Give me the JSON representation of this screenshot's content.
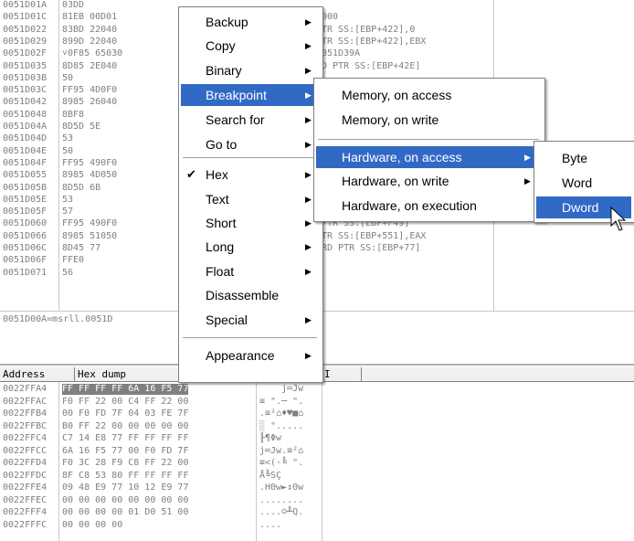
{
  "disasm": {
    "rows": [
      {
        "addr": "0051D01A",
        "hex": "03DD",
        "cmt": ""
      },
      {
        "addr": "0051D01C",
        "hex": "81EB 00D01",
        "cmt": "000"
      },
      {
        "addr": "0051D022",
        "hex": "83BD 22040",
        "cmt": "TR SS:[EBP+422],0"
      },
      {
        "addr": "0051D029",
        "hex": "899D 22040",
        "cmt": "TR SS:[EBP+422],EBX"
      },
      {
        "addr": "0051D02F",
        "hex": "˅0F85 65030",
        "cmt": "051D39A"
      },
      {
        "addr": "0051D035",
        "hex": "8D85 2E040",
        "cmt": "D PTR SS:[EBP+42E]"
      },
      {
        "addr": "0051D03B",
        "hex": "50",
        "cmt": ""
      },
      {
        "addr": "0051D03C",
        "hex": "FF95 4D0F0",
        "cmt": ""
      },
      {
        "addr": "0051D042",
        "hex": "8985 26040",
        "cmt": ""
      },
      {
        "addr": "0051D048",
        "hex": "8BF8",
        "cmt": ""
      },
      {
        "addr": "0051D04A",
        "hex": "8D5D 5E",
        "cmt": ""
      },
      {
        "addr": "0051D04D",
        "hex": "53",
        "cmt": ""
      },
      {
        "addr": "0051D04E",
        "hex": "50",
        "cmt": ""
      },
      {
        "addr": "0051D04F",
        "hex": "FF95 490F0",
        "cmt": ""
      },
      {
        "addr": "0051D055",
        "hex": "8985 4D050",
        "cmt": ""
      },
      {
        "addr": "0051D05B",
        "hex": "8D5D 6B",
        "cmt": ""
      },
      {
        "addr": "0051D05E",
        "hex": "53",
        "cmt": ""
      },
      {
        "addr": "0051D05F",
        "hex": "57",
        "cmt": ""
      },
      {
        "addr": "0051D060",
        "hex": "FF95 490F0",
        "cmt": "PTR SS:[EBP+F49]"
      },
      {
        "addr": "0051D066",
        "hex": "8985 51050",
        "cmt": "TR SS:[EBP+551],EAX"
      },
      {
        "addr": "0051D06C",
        "hex": "8D45 77",
        "cmt": "RD PTR SS:[EBP+77]"
      },
      {
        "addr": "0051D06F",
        "hex": "FFE0",
        "cmt": ""
      },
      {
        "addr": "0051D071",
        "hex": "56",
        "cmt": ""
      }
    ]
  },
  "info_line": "0051D00A=msrll.0051D",
  "dump": {
    "header": {
      "address": "Address",
      "hex": "Hex dump",
      "ascii": "I"
    },
    "rows": [
      {
        "addr": "0022FFA4",
        "hex": "FF FF FF FF 6A 16 F5 77",
        "ascii": "    j═Jw"
      },
      {
        "addr": "0022FFAC",
        "hex": "F0 FF 22 00 C4 FF 22 00",
        "ascii": "≡ \".─ \"."
      },
      {
        "addr": "0022FFB4",
        "hex": "00 F0 FD 7F 04 03 FE 7F",
        "ascii": ".≡²⌂♦♥■⌂"
      },
      {
        "addr": "0022FFBC",
        "hex": "B0 FF 22 00 00 00 00 00",
        "ascii": "░ \"....."
      },
      {
        "addr": "0022FFC4",
        "hex": "C7 14 E8 77 FF FF FF FF",
        "ascii": "╟¶Φw    "
      },
      {
        "addr": "0022FFCC",
        "hex": "6A 16 F5 77 00 F0 FD 7F",
        "ascii": "j═Jw.≡²⌂"
      },
      {
        "addr": "0022FFD4",
        "hex": "F0 3C 28 F9 C8 FF 22 00",
        "ascii": "≡<(·╚ \"."
      },
      {
        "addr": "0022FFDC",
        "hex": "8F C8 53 80 FF FF FF FF",
        "ascii": "Å╚SÇ    "
      },
      {
        "addr": "0022FFE4",
        "hex": "09 48 E9 77 10 12 E9 77",
        "ascii": ".HΘw►↕Θw"
      },
      {
        "addr": "0022FFEC",
        "hex": "00 00 00 00 00 00 00 00",
        "ascii": "........"
      },
      {
        "addr": "0022FFF4",
        "hex": "00 00 00 00 01 D0 51 00",
        "ascii": "....☺╨Q."
      },
      {
        "addr": "0022FFFC",
        "hex": "00 00 00 00",
        "ascii": "...."
      }
    ]
  },
  "context_menu": {
    "items": [
      {
        "label": "Backup",
        "submenu": true
      },
      {
        "label": "Copy",
        "submenu": true
      },
      {
        "label": "Binary",
        "submenu": true
      },
      {
        "label": "Breakpoint",
        "submenu": true,
        "selected": true
      },
      {
        "label": "Search for",
        "submenu": true
      },
      {
        "label": "Go to",
        "submenu": true
      },
      {
        "label": "Hex",
        "submenu": true,
        "checked": true
      },
      {
        "label": "Text",
        "submenu": true
      },
      {
        "label": "Short",
        "submenu": true
      },
      {
        "label": "Long",
        "submenu": true
      },
      {
        "label": "Float",
        "submenu": true
      },
      {
        "label": "Disassemble",
        "submenu": false
      },
      {
        "label": "Special",
        "submenu": true
      },
      {
        "label": "Appearance",
        "submenu": true
      }
    ]
  },
  "breakpoint_menu": {
    "items": [
      {
        "label": "Memory, on access"
      },
      {
        "label": "Memory, on write"
      },
      {
        "label": "Hardware, on access",
        "submenu": true,
        "selected": true
      },
      {
        "label": "Hardware, on write",
        "submenu": true
      },
      {
        "label": "Hardware, on execution"
      }
    ]
  },
  "size_menu": {
    "items": [
      {
        "label": "Byte"
      },
      {
        "label": "Word"
      },
      {
        "label": "Dword",
        "selected": true
      }
    ]
  },
  "colors": {
    "selection": "#316ac5",
    "menu_bg": "#ffffff",
    "dump_highlight": "#808080"
  }
}
